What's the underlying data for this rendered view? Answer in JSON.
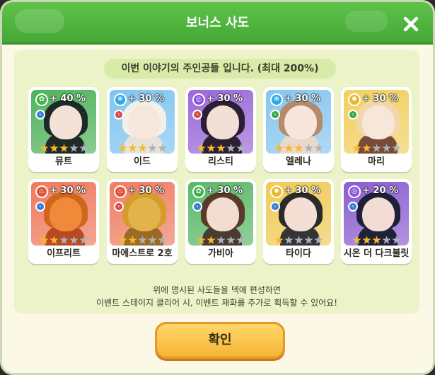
{
  "dialog": {
    "title": "보너스 사도",
    "subtitle": "이번 이야기의 주인공들 입니다. (최대 200%)",
    "note_line1": "위에 명시된 사도들을 덱에 편성하면",
    "note_line2": "이벤트 스테이지 클리어 시, 이벤트 재화를 추가로 획득할 수 있어요!",
    "confirm_label": "확인"
  },
  "characters": [
    {
      "name": "뮤트",
      "bonus": "+ 40 %",
      "element": "nature-icon",
      "element_color": "#3fb24a",
      "role": "arrow-icon",
      "role_color": "#3a7fd6",
      "card_bg": "#4fb35a",
      "hair": "#1e2a2a",
      "skin": "#f4e2d6",
      "body": "#1f2a28",
      "stars": 3
    },
    {
      "name": "이드",
      "bonus": "+ 30 %",
      "element": "ice-icon",
      "element_color": "#2fa7e0",
      "role": "arrow-icon",
      "role_color": "#d64a4a",
      "card_bg": "#7fc5f0",
      "hair": "#f3f0ea",
      "skin": "#f7e6dc",
      "body": "#e7e2da",
      "stars": 3
    },
    {
      "name": "리스티",
      "bonus": "+ 30 %",
      "element": "spiral-icon",
      "element_color": "#8a4fd8",
      "role": "arrow-icon",
      "role_color": "#d64a4a",
      "card_bg": "#9a68d8",
      "hair": "#2a1f35",
      "skin": "#f4dfd6",
      "body": "#2a2030",
      "stars": 3
    },
    {
      "name": "엘레나",
      "bonus": "+ 30 %",
      "element": "ice-icon",
      "element_color": "#2fa7e0",
      "role": "arrow-icon",
      "role_color": "#3aa84a",
      "card_bg": "#86c6ee",
      "hair": "#b48a6a",
      "skin": "#f7e4da",
      "body": "#e9d8cc",
      "stars": 3
    },
    {
      "name": "마리",
      "bonus": "+ 30 %",
      "element": "sun-icon",
      "element_color": "#e8b82a",
      "role": "arrow-icon",
      "role_color": "#3aa84a",
      "card_bg": "#f1cf5e",
      "hair": "#f2d8a8",
      "skin": "#f7e6da",
      "body": "#7a4a38",
      "stars": 2
    },
    {
      "name": "이프리트",
      "bonus": "+ 30 %",
      "element": "fire-icon",
      "element_color": "#e0543a",
      "role": "arrow-icon",
      "role_color": "#3a7fd6",
      "card_bg": "#ef7a5c",
      "hair": "#d0651c",
      "skin": "#f08a3a",
      "body": "#b84a22",
      "stars": 2
    },
    {
      "name": "마에스트로 2호",
      "bonus": "+ 30 %",
      "element": "fire-icon",
      "element_color": "#e0543a",
      "role": "arrow-icon",
      "role_color": "#d64a4a",
      "card_bg": "#ee7e62",
      "hair": "#d69b2c",
      "skin": "#e0b44a",
      "body": "#9c6a24",
      "stars": 2
    },
    {
      "name": "가비아",
      "bonus": "+ 30 %",
      "element": "nature-icon",
      "element_color": "#3fb24a",
      "role": "arrow-icon",
      "role_color": "#3a7fd6",
      "card_bg": "#5cb86a",
      "hair": "#5a3a2a",
      "skin": "#f3ddd0",
      "body": "#4a3a30",
      "stars": 2
    },
    {
      "name": "타이다",
      "bonus": "+ 30 %",
      "element": "sun-icon",
      "element_color": "#e8b82a",
      "role": "arrow-icon",
      "role_color": "#3a7fd6",
      "card_bg": "#f0cb58",
      "hair": "#2b2b2b",
      "skin": "#f4dfd4",
      "body": "#343434",
      "stars": 1
    },
    {
      "name": "시온 더 다크불릿",
      "bonus": "+ 20 %",
      "element": "spiral-icon",
      "element_color": "#8a4fd8",
      "role": "arrow-icon",
      "role_color": "#3a7fd6",
      "card_bg": "#8a5ed0",
      "hair": "#1f1f3a",
      "skin": "#f3dcd4",
      "body": "#22213a",
      "stars": 3
    }
  ],
  "colors": {
    "header": "#4cb23c",
    "star_on": "#f6b92c",
    "star_off": "#aab3bd",
    "button": "#f8c248"
  }
}
